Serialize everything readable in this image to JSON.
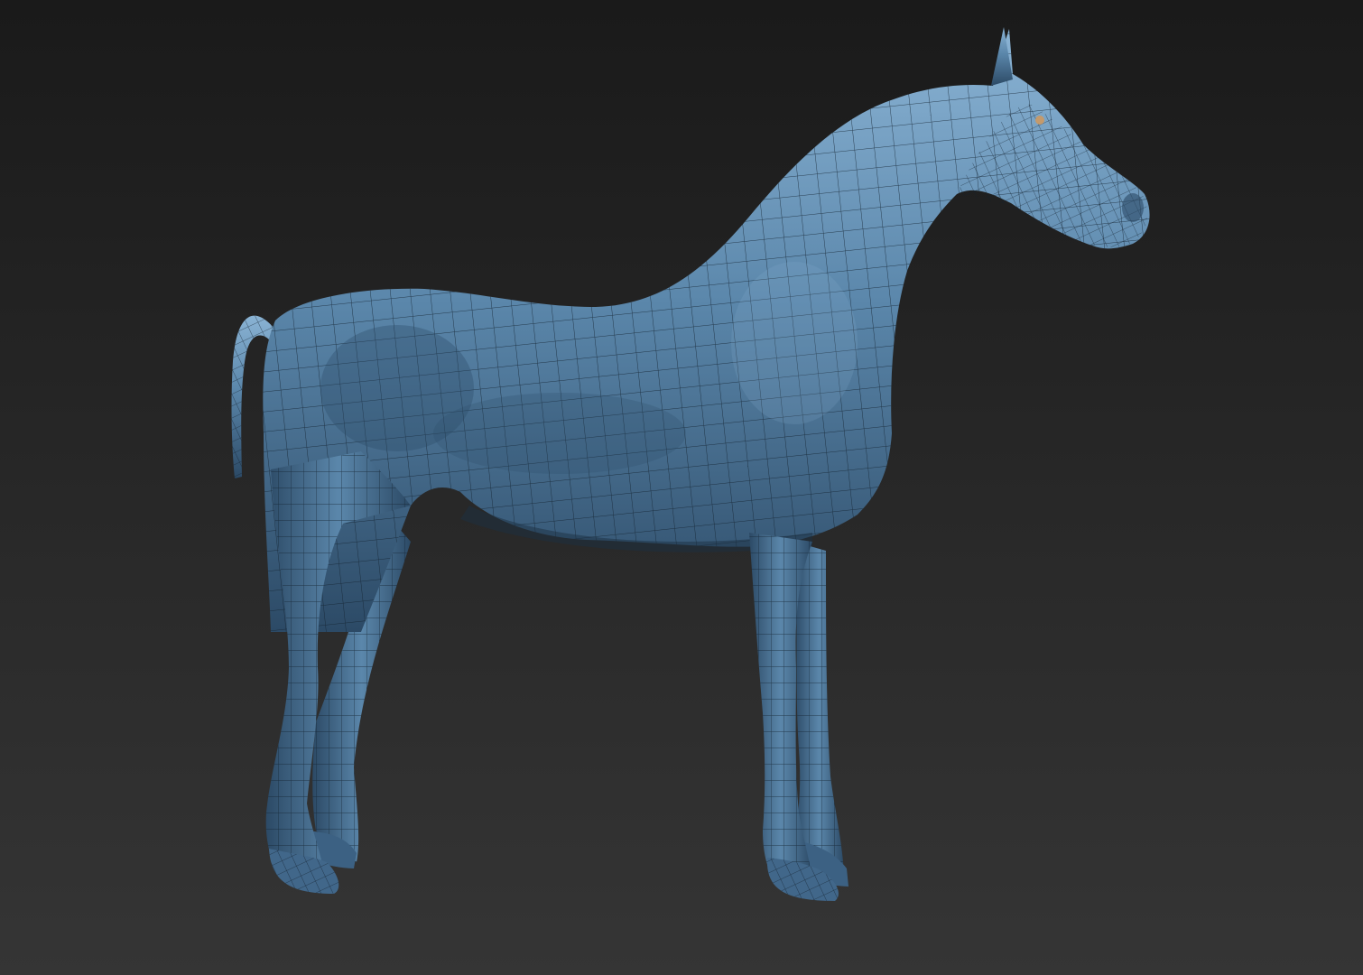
{
  "scene": {
    "background_top": "#1a1a1a",
    "background_bottom": "#353535",
    "subject": "horse-mesh",
    "mesh_color": "#5b87ab",
    "mesh_highlight": "#8ab3d4",
    "mesh_shadow": "#2c4a66",
    "wire_color": "#13212e",
    "eye_color": "#c49a6c"
  }
}
